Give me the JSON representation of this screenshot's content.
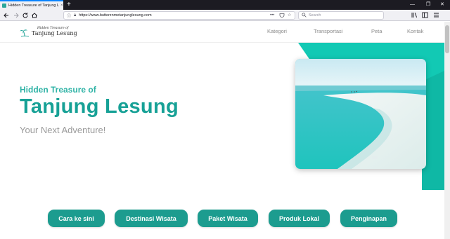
{
  "browser": {
    "tab_title": "Hidden Treasure of Tanjung Le",
    "tab_close": "×",
    "new_tab": "+",
    "url": "https://www.butterznmetanjunglesung.com",
    "search_placeholder": "Search",
    "win_min": "—",
    "win_max": "❐",
    "win_close": "✕",
    "icons": [
      "back-icon",
      "forward-icon",
      "reload-icon",
      "home-icon",
      "info-icon",
      "lock-icon",
      "menu-dots-icon",
      "pocket-icon",
      "bookmark-star-icon",
      "search-icon",
      "library-icon",
      "sidebar-icon",
      "hamburger-menu-icon"
    ]
  },
  "site": {
    "logo_top": "Hidden Treasure of",
    "logo_main": "Tanjung Lesung",
    "menu": [
      "Kategori",
      "Transportasi",
      "Peta",
      "Kontak"
    ]
  },
  "hero": {
    "small_title": "Hidden Treasure of",
    "big_title": "Tanjung Lesung",
    "subtitle": "Your Next Adventure!"
  },
  "buttons": [
    "Cara ke sini",
    "Destinasi Wisata",
    "Paket Wisata",
    "Produk Lokal",
    "Penginapan"
  ],
  "colors": {
    "accent": "#1c9c8f",
    "title": "#17a196",
    "subtitle": "#9a9a9a",
    "deco_teal": "#12c9b4"
  }
}
